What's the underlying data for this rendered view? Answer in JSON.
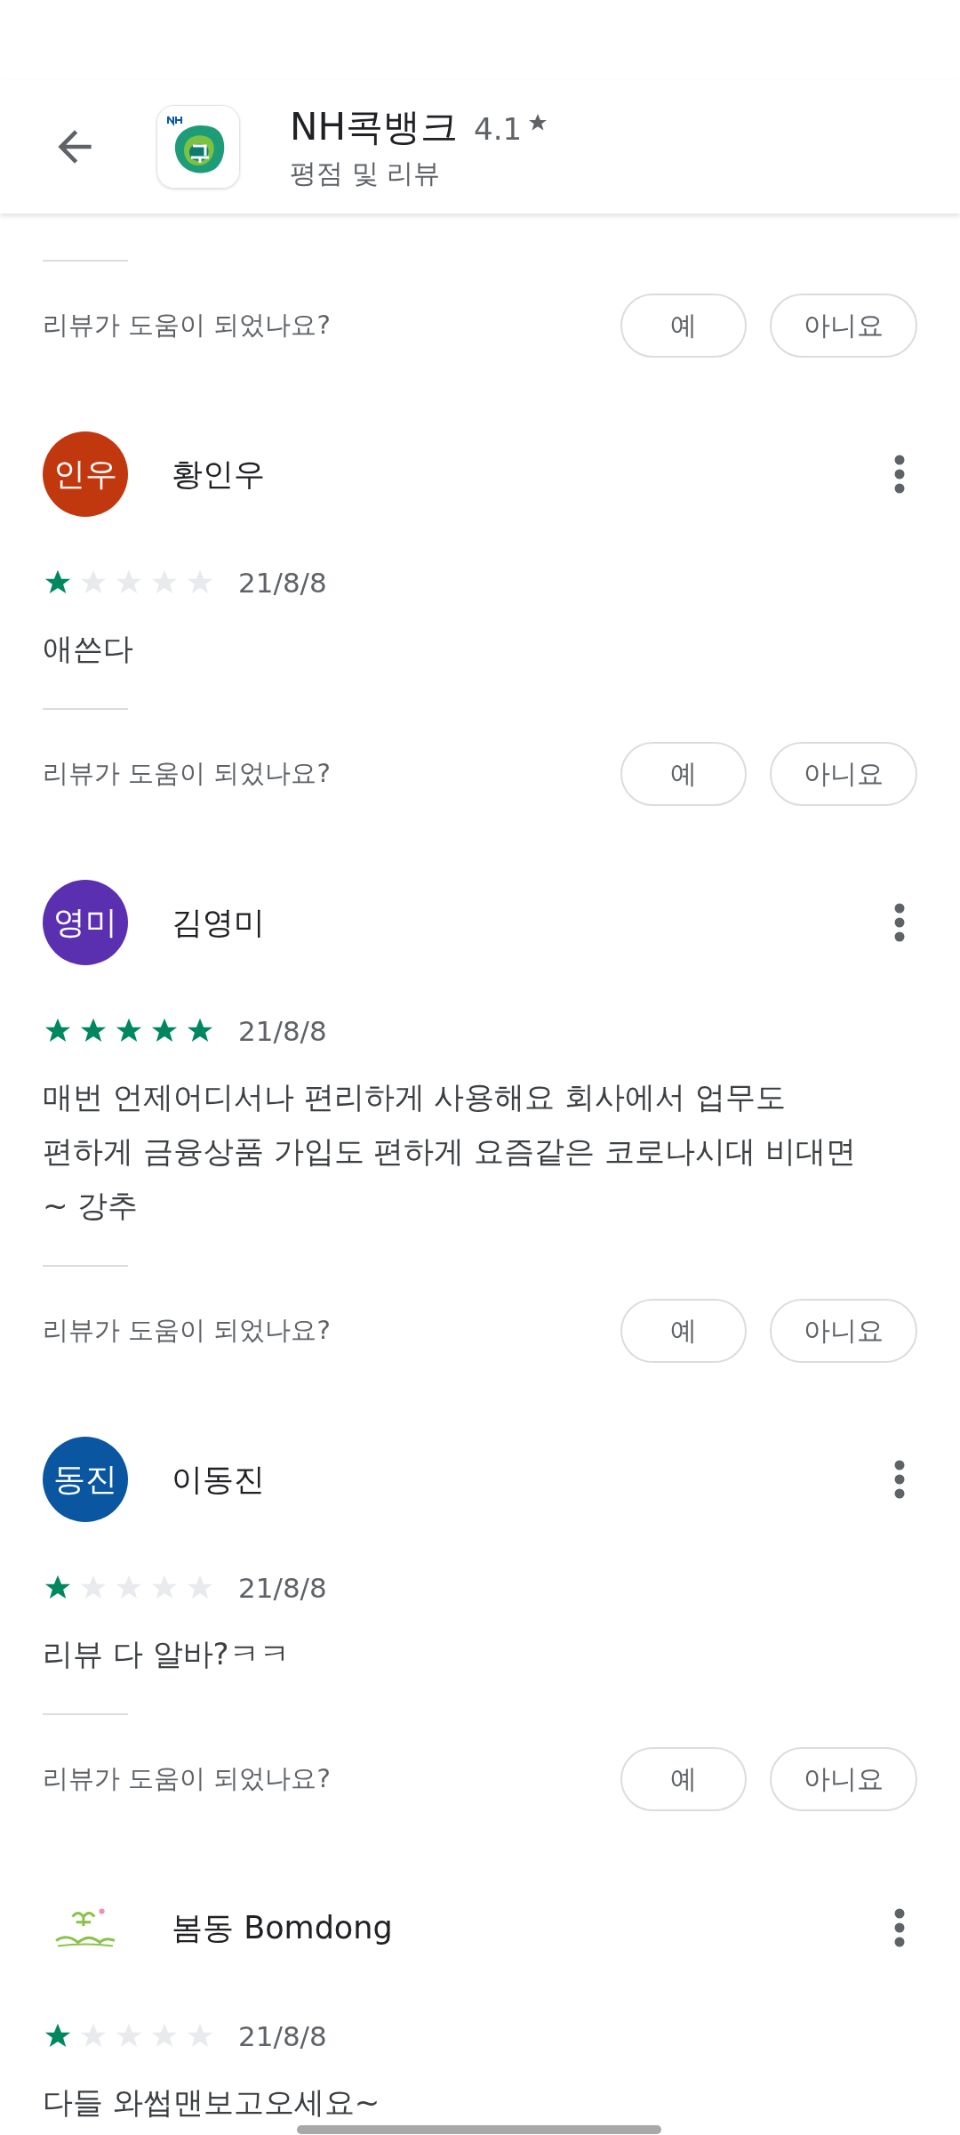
{
  "header": {
    "app_name": "NH콕뱅크",
    "rating": "4.1",
    "subtitle": "평점 및 리뷰"
  },
  "top_helpful": {
    "question": "리뷰가 도움이 되었나요?",
    "yes": "예",
    "no": "아니요"
  },
  "reviews": [
    {
      "avatar": {
        "kind": "initials",
        "text": "인우",
        "color": "#c1380f"
      },
      "name": "황인우",
      "stars": 1,
      "date": "21/8/8",
      "text": "애쓴다",
      "helpful": {
        "question": "리뷰가 도움이 되었나요?",
        "yes": "예",
        "no": "아니요"
      }
    },
    {
      "avatar": {
        "kind": "initials",
        "text": "영미",
        "color": "#5a2fb0"
      },
      "name": "김영미",
      "stars": 5,
      "date": "21/8/8",
      "text": "매번 언제어디서나 편리하게 사용해요 회사에서 업무도 편하게 금융상품 가입도 편하게 요즘같은 코로나시대 비대면~ 강추",
      "helpful": {
        "question": "리뷰가 도움이 되었나요?",
        "yes": "예",
        "no": "아니요"
      }
    },
    {
      "avatar": {
        "kind": "initials",
        "text": "동진",
        "color": "#0a56a0"
      },
      "name": "이동진",
      "stars": 1,
      "date": "21/8/8",
      "text": "리뷰 다 알바?ㅋㅋ",
      "helpful": {
        "question": "리뷰가 도움이 되었나요?",
        "yes": "예",
        "no": "아니요"
      }
    },
    {
      "name": "봄동 Bomdong",
      "stars": 1,
      "date": "21/8/8",
      "text": "다들 와썹맨보고오세요~"
    }
  ]
}
